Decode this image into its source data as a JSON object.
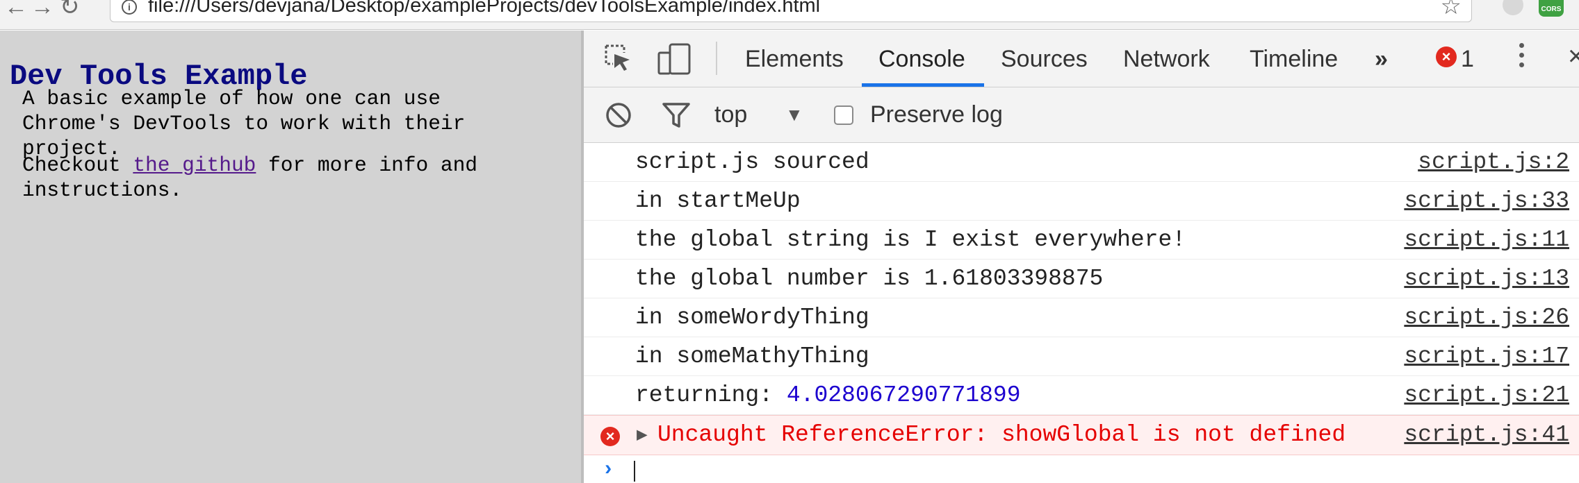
{
  "browser": {
    "url": "file:///Users/devjana/Desktop/exampleProjects/devToolsExample/index.html",
    "extension_label": "CORS"
  },
  "page": {
    "title": "Dev Tools Example",
    "paragraph1": "A basic example of how one can use Chrome's DevTools to work with their project.",
    "paragraph2_before": "Checkout ",
    "paragraph2_link": "the github",
    "paragraph2_after": " for more info and instructions.",
    "title_color": "#0a0a80",
    "link_color": "#551a8b",
    "background": "#d3d3d3"
  },
  "devtools": {
    "tabs": [
      {
        "label": "Elements"
      },
      {
        "label": "Console"
      },
      {
        "label": "Sources"
      },
      {
        "label": "Network"
      },
      {
        "label": "Timeline"
      }
    ],
    "active_tab": "Console",
    "more_tabs": "»",
    "error_count": "1",
    "accent_color": "#1a73e8",
    "toolbar": {
      "context": "top",
      "preserve_log_label": "Preserve log",
      "preserve_log_checked": false
    },
    "console": {
      "logs": [
        {
          "message": "script.js sourced",
          "source": "script.js:2"
        },
        {
          "message": "in startMeUp",
          "source": "script.js:33"
        },
        {
          "message": "the global string is I exist everywhere!",
          "source": "script.js:11"
        },
        {
          "message": "the global number is 1.61803398875",
          "source": "script.js:13"
        },
        {
          "message": "in someWordyThing",
          "source": "script.js:26"
        },
        {
          "message": "in someMathyThing",
          "source": "script.js:17"
        },
        {
          "message_prefix": "returning: ",
          "message_value": "4.028067290771899",
          "source": "script.js:21"
        }
      ],
      "error": {
        "message": "Uncaught ReferenceError: showGlobal is not defined",
        "source": "script.js:41",
        "color": "#e50000"
      },
      "prompt": "›"
    }
  }
}
